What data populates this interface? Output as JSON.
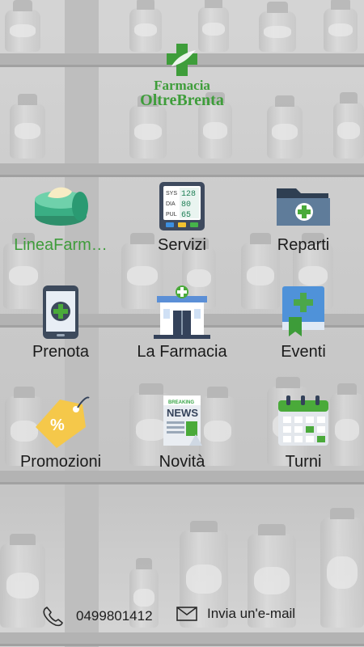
{
  "brand": {
    "line1": "Farmacia",
    "line2": "OltreBrenta",
    "color": "#3e9d3a"
  },
  "menu": [
    {
      "label": "LineaFarm…",
      "icon": "cream-jar-icon"
    },
    {
      "label": "Servizi",
      "icon": "blood-pressure-monitor-icon"
    },
    {
      "label": "Reparti",
      "icon": "folder-plus-icon"
    },
    {
      "label": "Prenota",
      "icon": "smartphone-plus-icon"
    },
    {
      "label": "La Farmacia",
      "icon": "pharmacy-building-icon"
    },
    {
      "label": "Eventi",
      "icon": "bookmark-book-icon"
    },
    {
      "label": "Promozioni",
      "icon": "price-tag-percent-icon"
    },
    {
      "label": "Novità",
      "icon": "newspaper-icon"
    },
    {
      "label": "Turni",
      "icon": "calendar-icon"
    }
  ],
  "monitor": {
    "sys_label": "SYS",
    "dia_label": "DIA",
    "pul_label": "PUL",
    "sys": "128",
    "dia": "80",
    "pul": "65"
  },
  "news_icon": {
    "top": "BREAKING",
    "big": "NEWS"
  },
  "footer": {
    "phone": "0499801412",
    "email_label": "Invia un'e-mail"
  },
  "colors": {
    "accent": "#3f9c3b",
    "text": "#1b1b1b"
  }
}
